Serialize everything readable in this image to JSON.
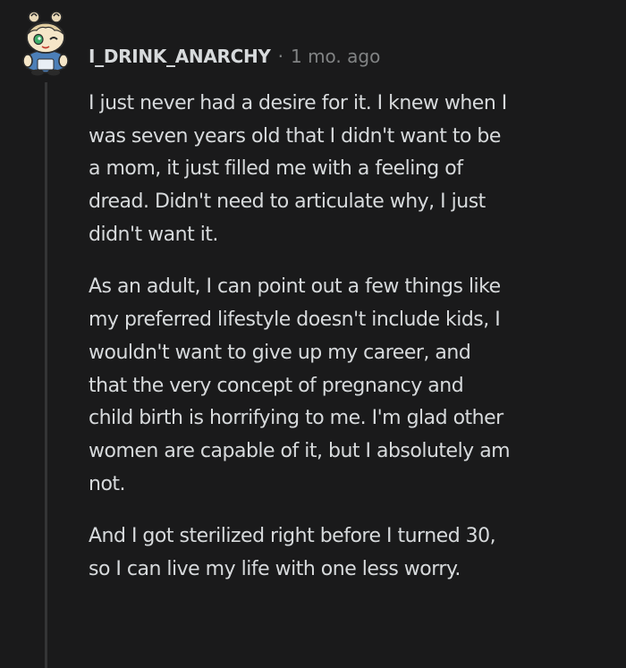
{
  "comment": {
    "username": "I_DRINK_ANARCHY",
    "separator": "·",
    "age": "1 mo. ago",
    "paragraphs": [
      {
        "lines": [
          "I just never had a desire for it. I knew when I",
          "was seven years old that I didn't want to be",
          "a mom, it just filled me with a feeling of",
          "dread. Didn't need to articulate why, I just",
          "didn't want it."
        ]
      },
      {
        "lines": [
          "As an adult, I can point out a few things like",
          "my preferred lifestyle doesn't include kids, I",
          "wouldn't want to give up my career, and",
          "that the very concept of pregnancy and",
          "child birth is horrifying to me. I'm glad other",
          "women are capable of it, but I absolutely am",
          "not."
        ]
      },
      {
        "lines": [
          "And I got sterilized right before I turned 30,",
          "so I can live my life with one less worry."
        ]
      }
    ]
  },
  "colors": {
    "background": "#1a1a1b",
    "text": "#d7dadc",
    "meta": "#818384",
    "thread_line": "#343536",
    "avatar_skin": "#f5e6c8",
    "avatar_eye": "#3fae6a"
  },
  "icons": {
    "avatar": "snoo-avatar-icon"
  }
}
